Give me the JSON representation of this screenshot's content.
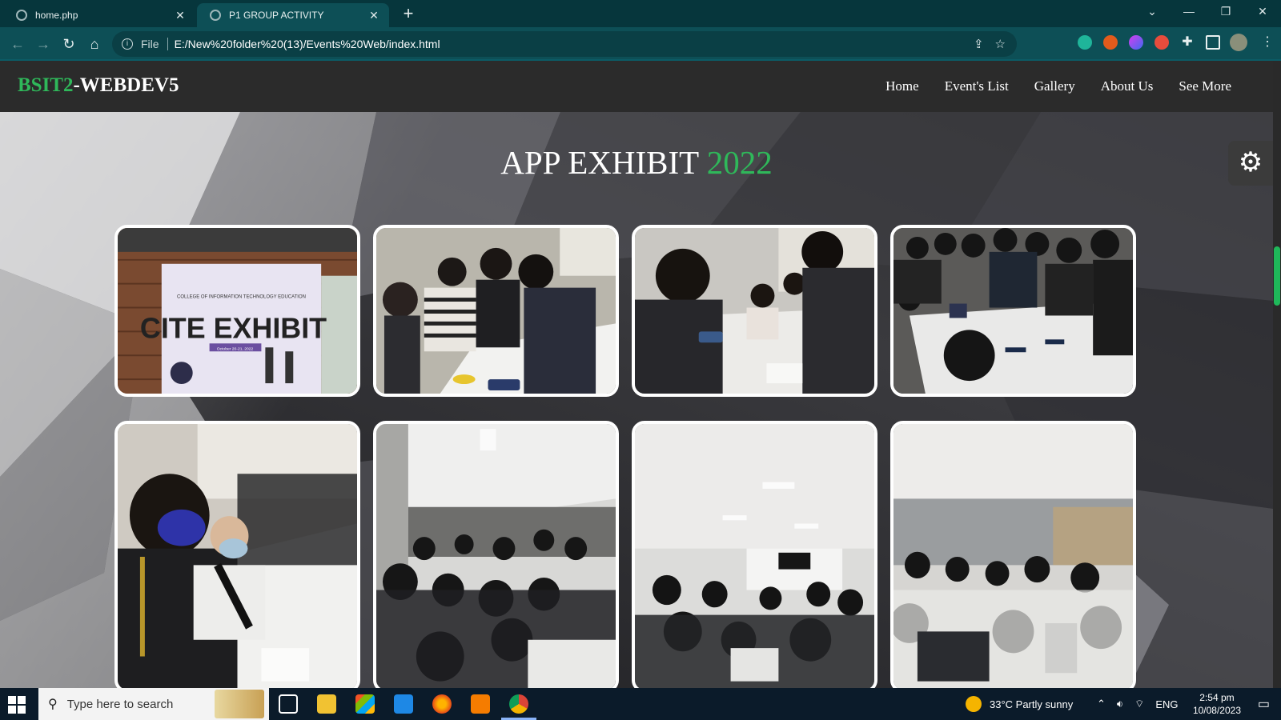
{
  "browser": {
    "tabs": [
      {
        "title": "home.php",
        "active": false
      },
      {
        "title": "P1 GROUP ACTIVITY",
        "active": true
      }
    ],
    "address": {
      "scheme_label": "File",
      "url": "E:/New%20folder%20(13)/Events%20Web/index.html"
    }
  },
  "site": {
    "logo_prefix": "BSIT2",
    "logo_suffix": "-WEBDEV5",
    "nav": [
      "Home",
      "Event's List",
      "Gallery",
      "About Us",
      "See More"
    ],
    "heading_main": "APP EXHIBIT",
    "heading_year": "2022",
    "banner_text": "CITE EXHIBIT",
    "banner_subtext": "COLLEGE OF INFORMATION TECHNOLOGY EDUCATION",
    "banner_date": "October 20-21, 2022"
  },
  "colors": {
    "accent_green": "#2fb85a",
    "nav_bg": "#2b2b2b",
    "taskbar_bg": "#0b1b2a"
  },
  "taskbar": {
    "search_placeholder": "Type here to search",
    "weather": "33°C  Partly sunny",
    "language": "ENG",
    "time": "2:54 pm",
    "date": "10/08/2023"
  }
}
